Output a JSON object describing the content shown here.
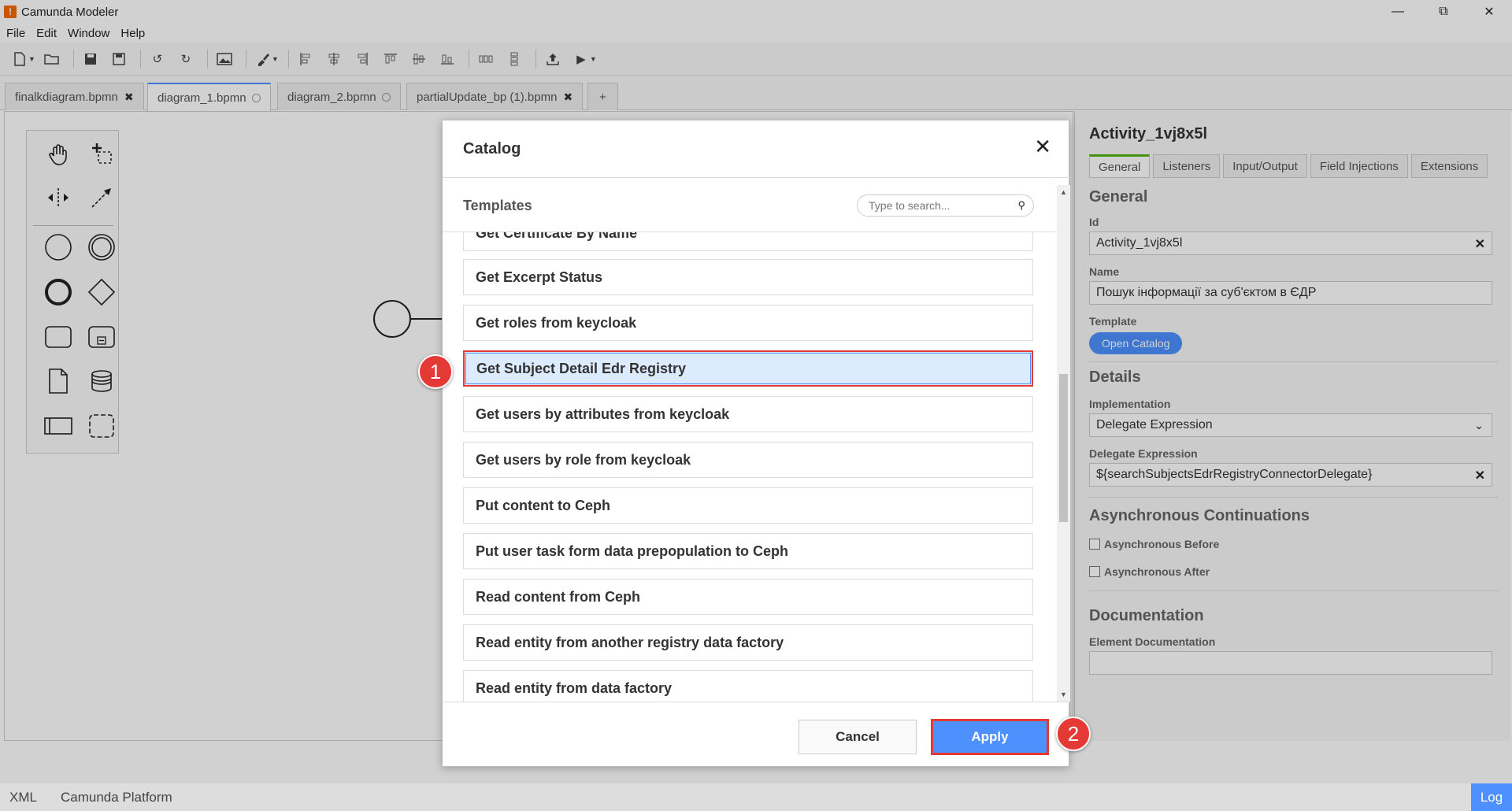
{
  "window": {
    "title": "Camunda Modeler",
    "icon_glyph": "!"
  },
  "menu": [
    "File",
    "Edit",
    "Window",
    "Help"
  ],
  "tabs": [
    {
      "label": "finalkdiagram.bpmn",
      "state": "close"
    },
    {
      "label": "diagram_1.bpmn",
      "state": "unsaved",
      "active": true
    },
    {
      "label": "diagram_2.bpmn",
      "state": "unsaved"
    },
    {
      "label": "partialUpdate_bp (1).bpmn",
      "state": "close"
    }
  ],
  "tab_add": "+",
  "properties": {
    "title": "Activity_1vj8x5l",
    "tabs": [
      "General",
      "Listeners",
      "Input/Output",
      "Field Injections",
      "Extensions"
    ],
    "general_title": "General",
    "id_label": "Id",
    "id_value": "Activity_1vj8x5l",
    "name_label": "Name",
    "name_value": "Пошук інформації за суб'єктом в ЄДР",
    "template_label": "Template",
    "open_catalog": "Open Catalog",
    "details_title": "Details",
    "impl_label": "Implementation",
    "impl_value": "Delegate Expression",
    "delegate_label": "Delegate Expression",
    "delegate_value": "${searchSubjectsEdrRegistryConnectorDelegate}",
    "async_title": "Asynchronous Continuations",
    "async_before": "Asynchronous Before",
    "async_after": "Asynchronous After",
    "doc_title": "Documentation",
    "doc_label": "Element Documentation"
  },
  "catalog": {
    "title": "Catalog",
    "templates_label": "Templates",
    "search_placeholder": "Type to search...",
    "items": [
      "Get Certificate By Name",
      "Get Excerpt Status",
      "Get roles from keycloak",
      "Get Subject Detail Edr Registry",
      "Get users by attributes from keycloak",
      "Get users by role from keycloak",
      "Put content to Ceph",
      "Put user task form data prepopulation to Ceph",
      "Read content from Ceph",
      "Read entity from another registry data factory",
      "Read entity from data factory"
    ],
    "selected": "Get Subject Detail Edr Registry",
    "cancel": "Cancel",
    "apply": "Apply"
  },
  "callouts": [
    "1",
    "2"
  ],
  "status": {
    "xml": "XML",
    "platform": "Camunda Platform",
    "log": "Log"
  },
  "colors": {
    "accent": "#4d90fe",
    "highlight": "#e53935",
    "selected_bg": "#dcebfd",
    "tab_green": "#52b415"
  }
}
